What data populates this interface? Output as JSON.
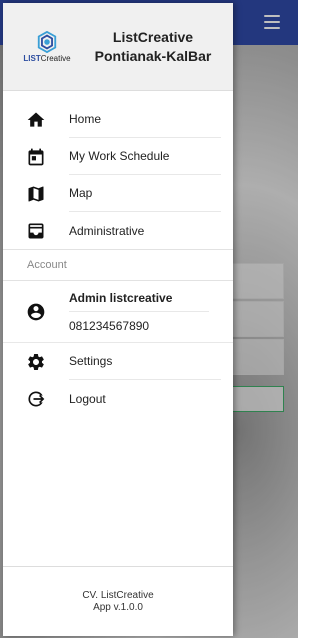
{
  "header": {
    "title_line1": "ListCreative",
    "title_line2": "Pontianak-KalBar",
    "logo_text_1": "LIST",
    "logo_text_2": "Creative"
  },
  "menu": [
    {
      "label": "Home",
      "icon": "home-icon"
    },
    {
      "label": "My Work Schedule",
      "icon": "calendar-icon"
    },
    {
      "label": "Map",
      "icon": "map-icon"
    },
    {
      "label": "Administrative",
      "icon": "inbox-icon"
    }
  ],
  "account": {
    "section_label": "Account",
    "name": "Admin listcreative",
    "phone": "081234567890"
  },
  "account_menu": [
    {
      "label": "Settings",
      "icon": "gear-icon"
    },
    {
      "label": "Logout",
      "icon": "logout-icon"
    }
  ],
  "footer": {
    "line1": "CV. ListCreative",
    "line2": "App v.1.0.0"
  },
  "colors": {
    "topbar": "#2f4aa8",
    "brand": "#2c4da0"
  }
}
